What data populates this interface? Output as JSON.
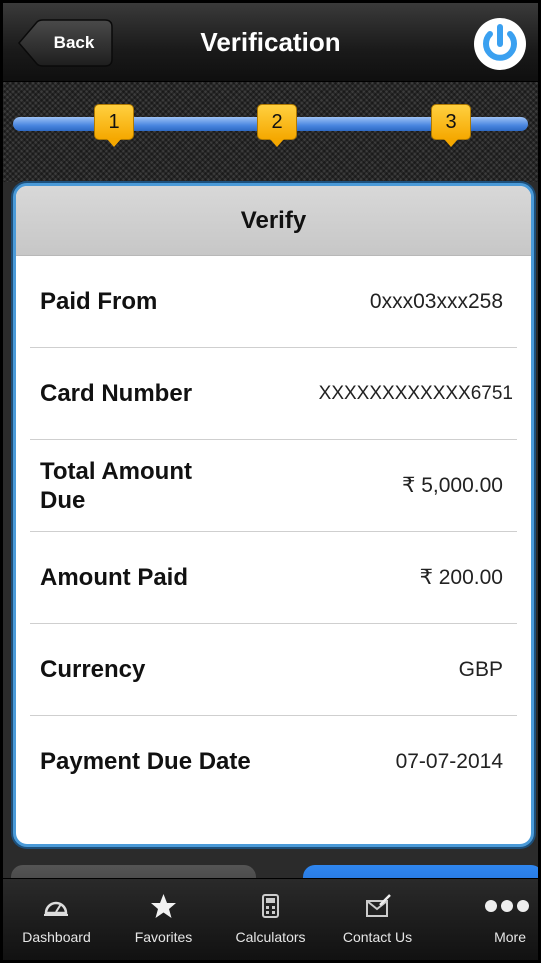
{
  "header": {
    "back_label": "Back",
    "title": "Verification"
  },
  "steps": [
    "1",
    "2",
    "3"
  ],
  "card": {
    "title": "Verify",
    "rows": [
      {
        "label": "Paid From",
        "value": "0xxx03xxx258"
      },
      {
        "label": "Card Number",
        "value": "XXXXXXXXXXXX6751"
      },
      {
        "label": "Total Amount Due",
        "value": "₹ 5,000.00"
      },
      {
        "label": "Amount Paid",
        "value": "₹ 200.00"
      },
      {
        "label": "Currency",
        "value": "GBP"
      },
      {
        "label": "Payment Due Date",
        "value": "07-07-2014"
      }
    ]
  },
  "tabs": [
    {
      "label": "Dashboard",
      "icon": "dashboard-icon"
    },
    {
      "label": "Favorites",
      "icon": "star-icon"
    },
    {
      "label": "Calculators",
      "icon": "calculator-icon"
    },
    {
      "label": "Contact Us",
      "icon": "contact-icon"
    },
    {
      "label": "More",
      "icon": "more-icon"
    }
  ],
  "colors": {
    "accent": "#4a86e0",
    "step": "#f5a800",
    "power": "#3aa0f0"
  }
}
